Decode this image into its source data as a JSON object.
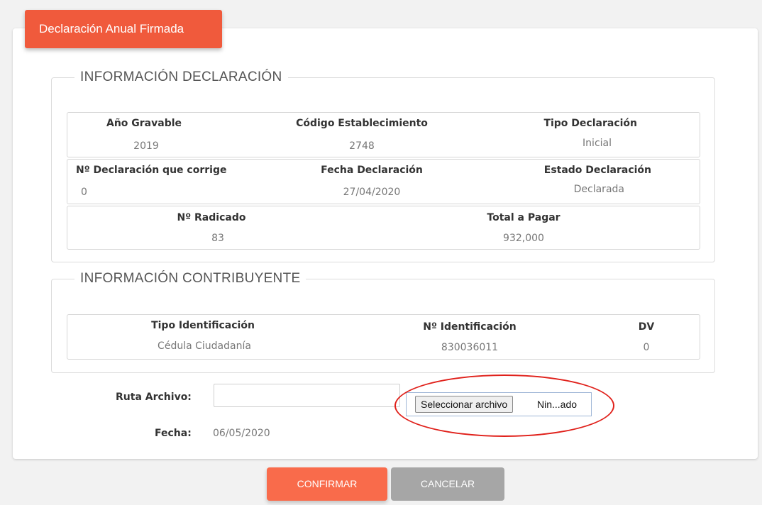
{
  "card": {
    "title": "Declaración Anual Firmada"
  },
  "declaracion": {
    "legend": "INFORMACIÓN DECLARACIÓN",
    "anio_gravable": {
      "label": "Año Gravable",
      "value": "2019"
    },
    "codigo_establecimiento": {
      "label": "Código Establecimiento",
      "value": "2748"
    },
    "tipo_declaracion": {
      "label": "Tipo Declaración",
      "value": "Inicial"
    },
    "declaracion_corrige": {
      "label": "Nº Declaración que corrige",
      "value": "0"
    },
    "fecha_declaracion": {
      "label": "Fecha Declaración",
      "value": "27/04/2020"
    },
    "estado_declaracion": {
      "label": "Estado Declaración",
      "value": "Declarada"
    },
    "radicado": {
      "label": "Nº Radicado",
      "value": "83"
    },
    "total_pagar": {
      "label": "Total a Pagar",
      "value": "932,000"
    }
  },
  "contribuyente": {
    "legend": "INFORMACIÓN CONTRIBUYENTE",
    "tipo_identificacion": {
      "label": "Tipo Identificación",
      "value": "Cédula Ciudadanía"
    },
    "identificacion": {
      "label": "Nº Identificación",
      "value": "830036011"
    },
    "dv": {
      "label": "DV",
      "value": "0"
    }
  },
  "form": {
    "ruta_label": "Ruta Archivo:",
    "ruta_value": "",
    "file_button": "Seleccionar archivo",
    "file_name": "Nin...ado",
    "fecha_label": "Fecha:",
    "fecha_value": "06/05/2020"
  },
  "actions": {
    "confirm": "CONFIRMAR",
    "cancel": "CANCELAR"
  },
  "colors": {
    "accent": "#f05a3c",
    "confirm": "#f96b4b",
    "cancel": "#a6a6a6",
    "annotation": "#e0201a"
  }
}
